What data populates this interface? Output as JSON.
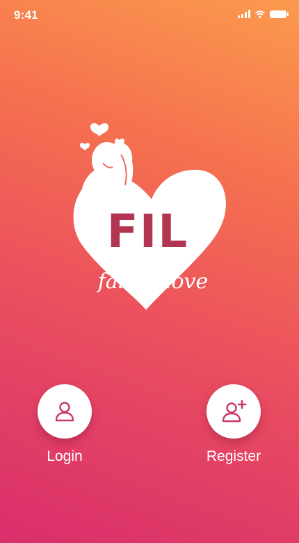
{
  "status_bar": {
    "time": "9:41",
    "icons": [
      "cellular-signal-icon",
      "wifi-icon",
      "battery-icon"
    ]
  },
  "logo": {
    "title": "FIL",
    "tagline": "fall in love"
  },
  "actions": {
    "login": {
      "label": "Login",
      "icon": "user-icon"
    },
    "register": {
      "label": "Register",
      "icon": "user-plus-icon"
    }
  },
  "colors": {
    "gradient_top": "#fb9a4e",
    "gradient_bottom": "#d92e6c",
    "accent": "#b23652"
  }
}
